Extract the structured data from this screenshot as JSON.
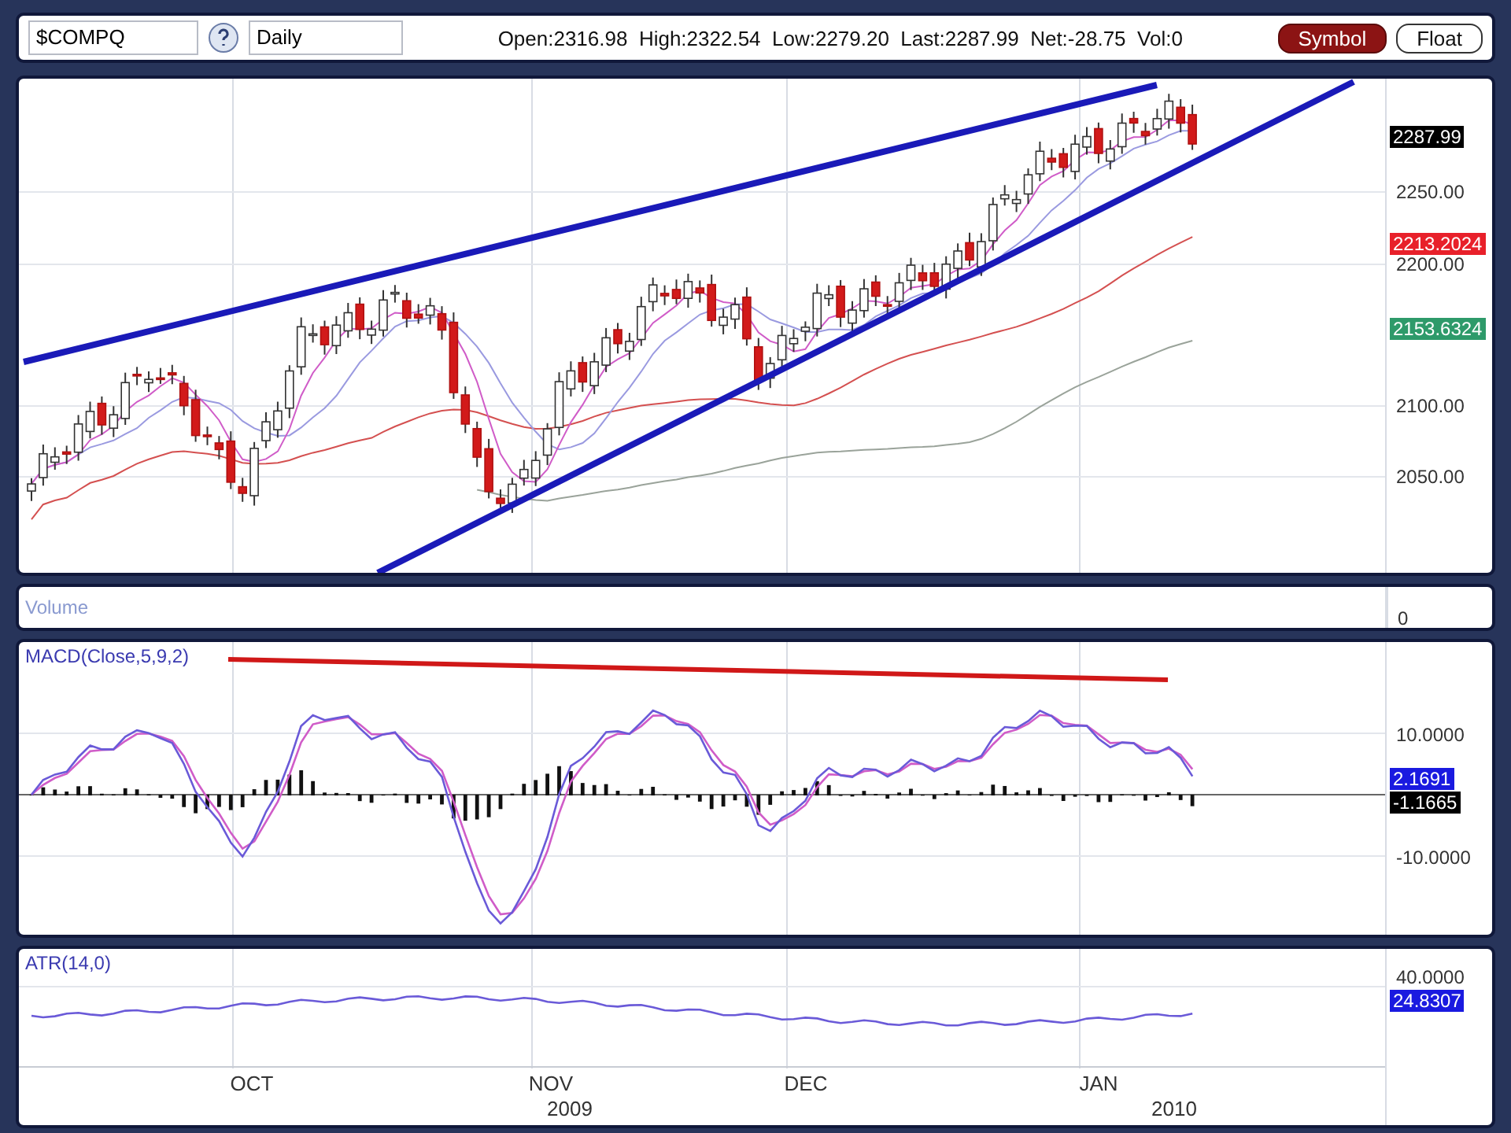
{
  "toolbar": {
    "symbol": "$COMPQ",
    "period": "Daily",
    "quote": "Open:2316.98  High:2322.54  Low:2279.20  Last:2287.99  Net:-28.75  Vol:0",
    "buttons": [
      {
        "label": "Symbol",
        "selected": true
      },
      {
        "label": "Float",
        "selected": false
      }
    ]
  },
  "price_panel": {
    "axis_labels": [
      "2250.00",
      "2200.00",
      "2100.00",
      "2050.00"
    ],
    "value_tags": [
      {
        "text": "2287.99",
        "color": "#000000"
      },
      {
        "text": "2213.2024",
        "color": "#e8202a"
      },
      {
        "text": "2153.6324",
        "color": "#2e9a6a"
      }
    ]
  },
  "volume_panel": {
    "title": "Volume",
    "axis_labels": [
      "0"
    ]
  },
  "macd_panel": {
    "title": "MACD(Close,5,9,2)",
    "axis_labels": [
      "10.0000",
      "-10.0000"
    ],
    "value_tags": [
      {
        "text": "2.1691",
        "color": "#1a1ae0"
      },
      {
        "text": "-1.1665",
        "color": "#000000"
      }
    ]
  },
  "atr_panel": {
    "title": "ATR(14,0)",
    "axis_labels": [
      "40.0000"
    ],
    "value_tags": [
      {
        "text": "24.8307",
        "color": "#1a1ae0"
      }
    ]
  },
  "x_axis": {
    "months": [
      "OCT",
      "NOV",
      "DEC",
      "JAN"
    ],
    "years": [
      "2009",
      "2010"
    ]
  }
}
